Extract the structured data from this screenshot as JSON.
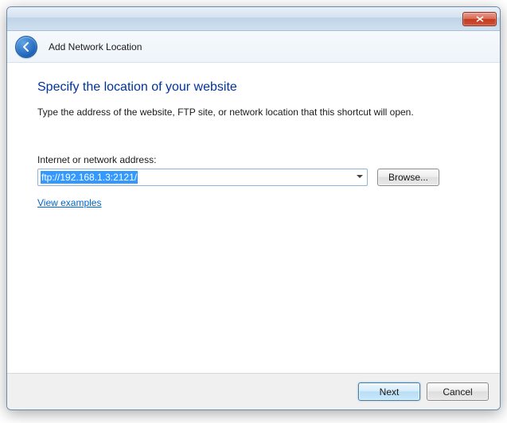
{
  "window": {
    "title": "Add Network Location"
  },
  "wizard": {
    "heading": "Specify the location of your website",
    "description": "Type the address of the website, FTP site, or network location that this shortcut will open.",
    "address_label": "Internet or network address:",
    "address_value": "ftp://192.168.1.3:2121/",
    "browse_label": "Browse...",
    "examples_link": "View examples"
  },
  "footer": {
    "next": "Next",
    "cancel": "Cancel"
  }
}
